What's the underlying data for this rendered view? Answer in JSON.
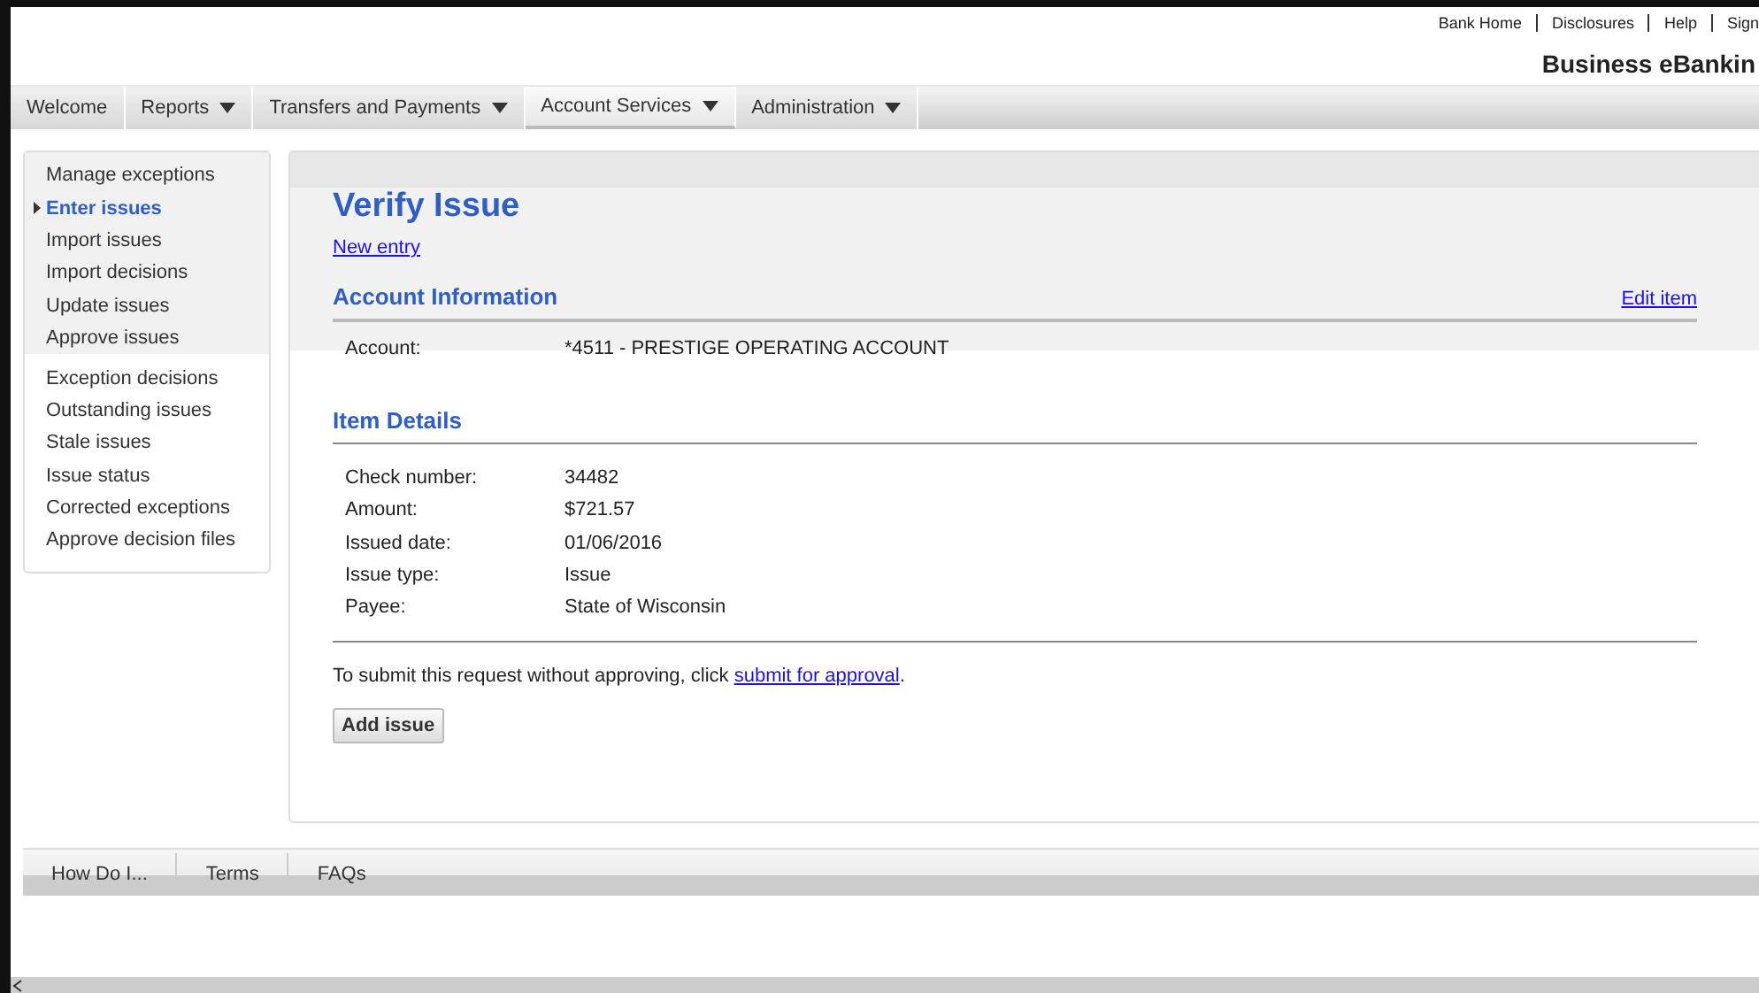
{
  "top_links": [
    "Bank Home",
    "Disclosures",
    "Help",
    "Sign"
  ],
  "brand": "Business eBankin",
  "nav": [
    {
      "label": "Welcome",
      "has_menu": false,
      "selected": false
    },
    {
      "label": "Reports",
      "has_menu": true,
      "selected": false
    },
    {
      "label": "Transfers and Payments",
      "has_menu": true,
      "selected": false
    },
    {
      "label": "Account Services",
      "has_menu": true,
      "selected": true
    },
    {
      "label": "Administration",
      "has_menu": true,
      "selected": false
    }
  ],
  "sidebar": {
    "groups": [
      {
        "shaded": true,
        "items": [
          {
            "label": "Manage exceptions",
            "selected": false
          },
          {
            "label": "Enter issues",
            "selected": true
          },
          {
            "label": "Import issues",
            "selected": false
          },
          {
            "label": "Import decisions",
            "selected": false
          },
          {
            "label": "Update issues",
            "selected": false
          },
          {
            "label": "Approve issues",
            "selected": false
          }
        ]
      },
      {
        "shaded": false,
        "items": [
          {
            "label": "Exception decisions",
            "selected": false
          },
          {
            "label": "Outstanding issues",
            "selected": false
          },
          {
            "label": "Stale issues",
            "selected": false
          },
          {
            "label": "Issue status",
            "selected": false
          },
          {
            "label": "Corrected exceptions",
            "selected": false
          },
          {
            "label": "Approve decision files",
            "selected": false
          }
        ]
      }
    ]
  },
  "page": {
    "title": "Verify Issue",
    "new_entry_link": "New entry",
    "account_section": {
      "heading": "Account Information",
      "edit_link": "Edit item",
      "fields": [
        {
          "label": "Account:",
          "value": "*4511 - PRESTIGE OPERATING ACCOUNT"
        }
      ]
    },
    "item_section": {
      "heading": "Item Details",
      "fields": [
        {
          "label": "Check number:",
          "value": "34482"
        },
        {
          "label": "Amount:",
          "value": "$721.57"
        },
        {
          "label": "Issued date:",
          "value": "01/06/2016"
        },
        {
          "label": "Issue type:",
          "value": "Issue"
        },
        {
          "label": "Payee:",
          "value": "State of Wisconsin"
        }
      ]
    },
    "submit_note": {
      "text": "To submit this request without approving, click ",
      "link": "submit for approval",
      "end": "."
    },
    "button": "Add issue"
  },
  "footer": [
    "How Do I...",
    "Terms",
    "FAQs"
  ]
}
